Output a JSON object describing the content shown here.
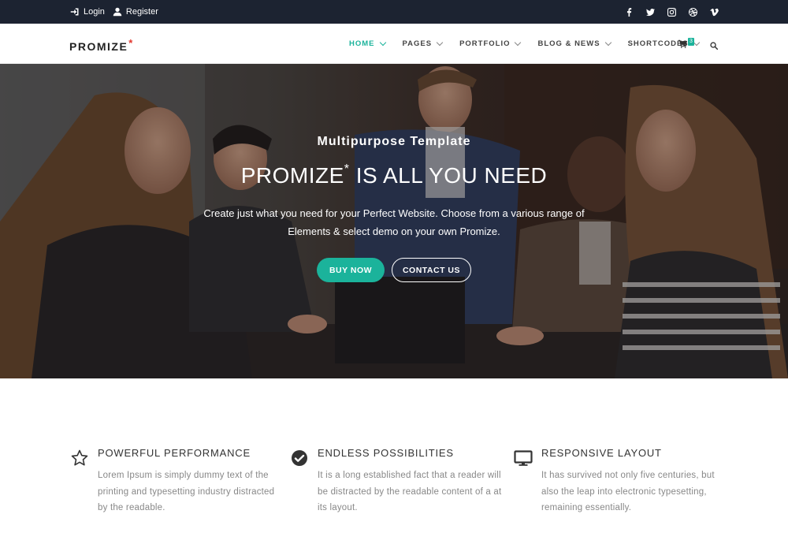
{
  "topbar": {
    "login": "Login",
    "register": "Register",
    "social": [
      "facebook-icon",
      "twitter-icon",
      "instagram-icon",
      "dribbble-icon",
      "vimeo-icon"
    ]
  },
  "nav": {
    "logo": "PROMIZE",
    "logo_mark": "*",
    "items": [
      {
        "label": "HOME",
        "active": true
      },
      {
        "label": "PAGES",
        "active": false
      },
      {
        "label": "PORTFOLIO",
        "active": false
      },
      {
        "label": "BLOG & NEWS",
        "active": false
      },
      {
        "label": "SHORTCODES",
        "active": false
      }
    ],
    "cart_count": "3"
  },
  "hero": {
    "subtitle": "Multipurpose Template",
    "title_part1": "PROMIZE",
    "title_mark": "*",
    "title_part2": " IS ALL YOU NEED",
    "description": "Create just what you need for your Perfect Website. Choose from a various range of Elements & select demo on your own Promize.",
    "buy_button": "BUY NOW",
    "contact_button": "CONTACT US"
  },
  "features": [
    {
      "icon": "star-icon",
      "title": "POWERFUL PERFORMANCE",
      "text": "Lorem Ipsum is simply dummy text of the printing and typesetting industry distracted by the readable."
    },
    {
      "icon": "check-circle-icon",
      "title": "ENDLESS POSSIBILITIES",
      "text": "It is a long established fact that a reader will be distracted by the readable content of a at its layout."
    },
    {
      "icon": "monitor-icon",
      "title": "RESPONSIVE LAYOUT",
      "text": "It has survived not only five centuries, but also the leap into electronic typesetting, remaining essentially."
    }
  ],
  "colors": {
    "accent": "#1bb39b",
    "topbar": "#1c2331",
    "logo_mark": "#e2392f"
  }
}
